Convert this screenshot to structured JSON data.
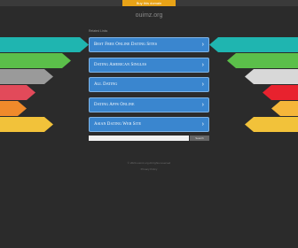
{
  "topbar": {
    "buy_label": "Buy this domain"
  },
  "domain": "ouimz.org",
  "related_label": "Related Links",
  "links": [
    {
      "label": "Best Free Online Dating Sites"
    },
    {
      "label": "Dating American Singles"
    },
    {
      "label": "All Dating"
    },
    {
      "label": "Dating Apps Online"
    },
    {
      "label": "Asian Dating Web Site"
    }
  ],
  "search": {
    "button_label": "Search",
    "placeholder": ""
  },
  "footer": {
    "line": "© 2024 ouimz.org All rights reserved",
    "privacy": "Privacy Policy"
  },
  "colors": {
    "button": "#3a86cf",
    "arrows": [
      "#1fb5b0",
      "#5bbf4a",
      "#9a9a9a",
      "#e24a5a",
      "#f08a2b",
      "#f2c23a"
    ]
  }
}
